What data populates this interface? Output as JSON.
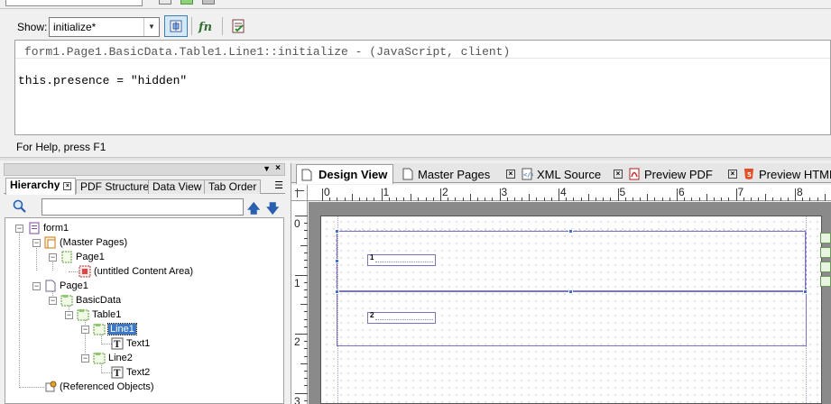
{
  "toolbar": {
    "show_label": "Show:",
    "show_value": "initialize*"
  },
  "script": {
    "header": "form1.Page1.BasicData.Table1.Line1::initialize - (JavaScript, client)",
    "code": "this.presence = \"hidden\""
  },
  "status": {
    "help": "For Help, press F1"
  },
  "hierarchy": {
    "tabs": [
      {
        "label": "Hierarchy"
      },
      {
        "label": "PDF Structure"
      },
      {
        "label": "Data View"
      },
      {
        "label": "Tab Order"
      }
    ],
    "tree": [
      {
        "label": "form1",
        "icon": "form-icon"
      },
      {
        "label": "(Master Pages)",
        "icon": "master-pages-icon"
      },
      {
        "label": "Page1",
        "icon": "page-icon"
      },
      {
        "label": "(untitled Content Area)",
        "icon": "content-area-icon"
      },
      {
        "label": "Page1",
        "icon": "page-icon"
      },
      {
        "label": "BasicData",
        "icon": "subform-icon"
      },
      {
        "label": "Table1",
        "icon": "table-icon"
      },
      {
        "label": "Line1",
        "icon": "row-icon"
      },
      {
        "label": "Text1",
        "icon": "text-field-icon"
      },
      {
        "label": "Line2",
        "icon": "row-icon"
      },
      {
        "label": "Text2",
        "icon": "text-field-icon"
      },
      {
        "label": "(Referenced Objects)",
        "icon": "referenced-objects-icon"
      }
    ]
  },
  "design": {
    "tabs": [
      {
        "label": "Design View"
      },
      {
        "label": "Master Pages"
      },
      {
        "label": "XML Source"
      },
      {
        "label": "Preview PDF"
      },
      {
        "label": "Preview HTML"
      }
    ],
    "ruler_h": [
      "0",
      "1",
      "2",
      "3",
      "4",
      "5",
      "6",
      "7",
      "8"
    ],
    "ruler_v": [
      "0",
      "1",
      "2",
      "3"
    ],
    "row_labels": [
      "1",
      "2"
    ]
  }
}
